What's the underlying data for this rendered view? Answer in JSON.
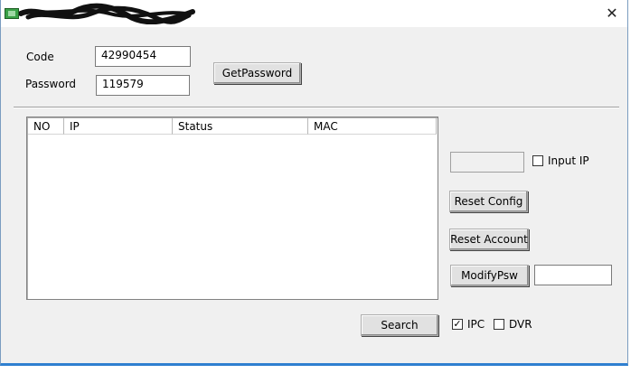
{
  "window": {
    "close_glyph": "✕"
  },
  "form": {
    "code_label": "Code",
    "code_value": "42990454",
    "password_label": "Password",
    "password_value": "119579",
    "get_password_label": "GetPassword"
  },
  "device_list": {
    "columns": [
      "NO",
      "IP",
      "Status",
      "MAC"
    ],
    "rows": []
  },
  "side_panel": {
    "ip_value": "",
    "input_ip_label": "Input IP",
    "input_ip_checked": false,
    "reset_config_label": "Reset Config",
    "reset_account_label": "Reset Account",
    "modify_psw_label": "ModifyPsw",
    "modify_psw_value": ""
  },
  "footer": {
    "search_label": "Search",
    "ipc_label": "IPC",
    "ipc_check_glyph": "✓",
    "dvr_label": "DVR",
    "dvr_check_glyph": ""
  },
  "icons": {
    "app": "app-icon",
    "close": "close-icon"
  }
}
